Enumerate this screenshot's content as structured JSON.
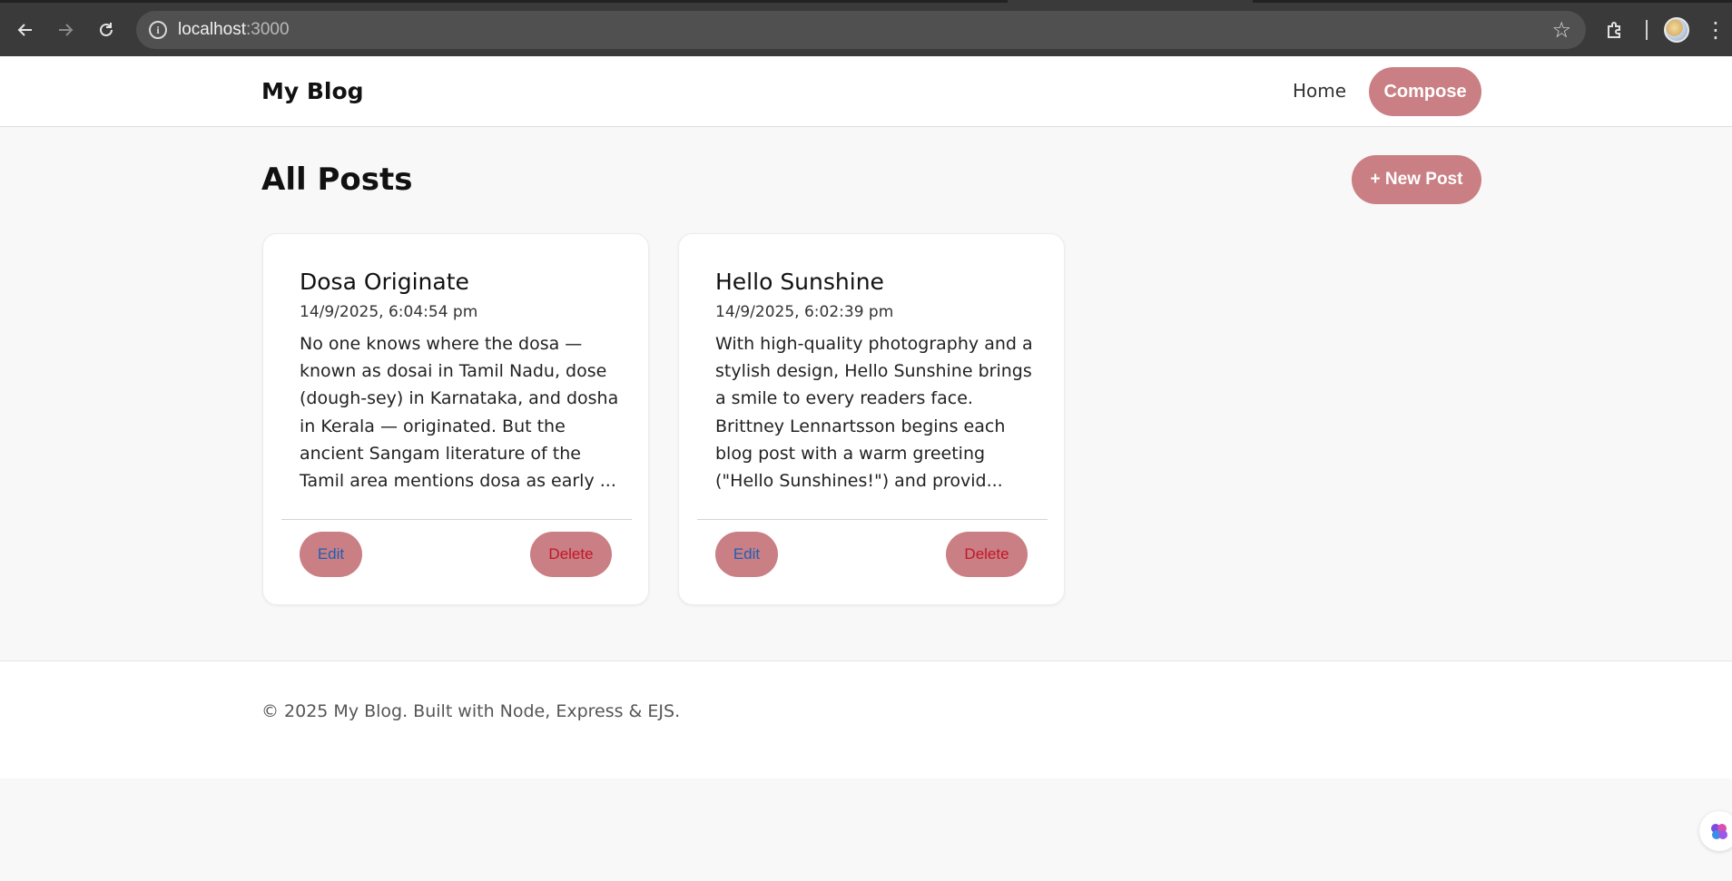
{
  "browser": {
    "url_host": "localhost",
    "url_port": ":3000",
    "icons": {
      "back": "back-arrow-icon",
      "forward": "forward-arrow-icon",
      "reload": "reload-icon",
      "site_info": "info-icon",
      "bookmark": "star-icon",
      "extensions": "puzzle-icon",
      "menu": "more-vert-icon"
    }
  },
  "header": {
    "brand": "My Blog",
    "nav": {
      "home": "Home",
      "compose": "Compose"
    }
  },
  "main": {
    "title": "All Posts",
    "new_post_label": "+ New Post",
    "posts": [
      {
        "title": "Dosa Originate",
        "date": "14/9/2025, 6:04:54 pm",
        "excerpt": "No one knows where the dosa — known as dosai in Tamil Nadu, dose (dough-sey) in Karnataka, and dosha in Kerala — originated. But the ancient Sangam literature of the Tamil area mentions dosa as early ...",
        "edit_label": "Edit",
        "delete_label": "Delete"
      },
      {
        "title": "Hello Sunshine",
        "date": "14/9/2025, 6:02:39 pm",
        "excerpt": "With high-quality photography and a stylish design, Hello Sunshine brings a smile to every readers face. Brittney Lennartsson begins each blog post with a warm greeting (\"Hello Sunshines!\") and provid...",
        "edit_label": "Edit",
        "delete_label": "Delete"
      }
    ]
  },
  "footer": {
    "text": "© 2025 My Blog. Built with Node, Express & EJS."
  },
  "colors": {
    "accent": "#c97f83",
    "edit_text": "#1f5fb8",
    "delete_text": "#c2162b",
    "page_bg": "#f8f8f8"
  }
}
